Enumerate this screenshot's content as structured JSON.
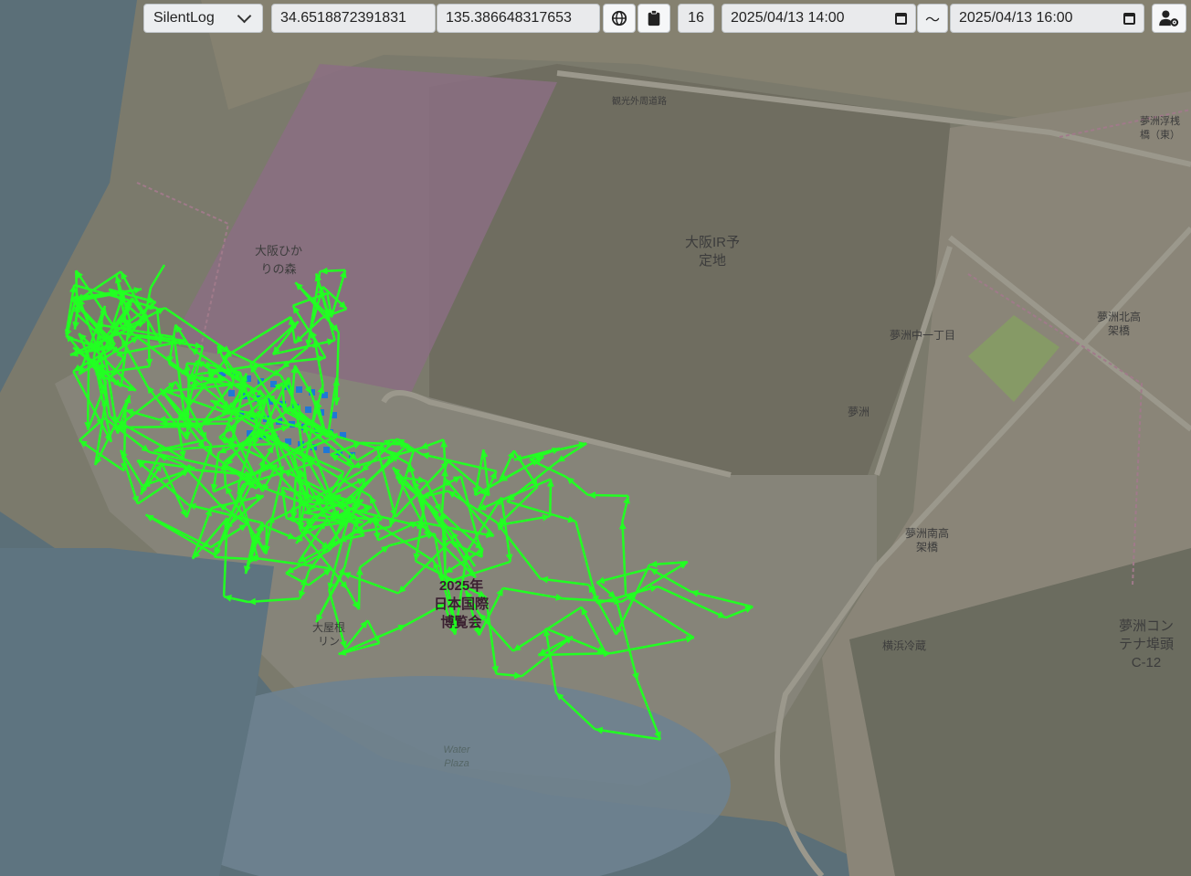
{
  "toolbar": {
    "mode_select": "SilentLog",
    "latitude": "34.6518872391831",
    "longitude": "135.386648317653",
    "zoom": "16",
    "start_datetime": "2025/04/13 14:00",
    "range_separator": "〜",
    "end_datetime": "2025/04/13 16:00"
  },
  "icons": {
    "globe": "globe-icon",
    "clipboard": "clipboard-icon",
    "user_settings": "user-cog-icon",
    "calendar": "calendar-icon",
    "chevron": "chevron-down-icon"
  },
  "map": {
    "labels": {
      "osaka_ir": "大阪IR予\n定地",
      "hikari_forest": "大阪ひか\nりの森",
      "yumeshima_1": "夢洲中一丁目",
      "yumeshima": "夢洲",
      "north_bridge": "夢洲北高\n架橋",
      "south_bridge": "夢洲南高\n架橋",
      "container_terminal": "夢洲コン\nテナ埠頭\nC-12",
      "east_bridge": "夢洲浮桟\n橋（東）",
      "yokohama_reizo": "横浜冷蔵",
      "road_1": "観光外周道路",
      "water_plaza": "Water\nPlaza",
      "ring": "大屋根\nリン",
      "expo": "2025年\n日本国際\n博覧会"
    },
    "colors": {
      "water": "#5b6f78",
      "land": "#7c7c6e",
      "site": "#8f8b82",
      "forest": "#8a6f82",
      "track": "#22ff22",
      "marker": "#1f78d6"
    }
  }
}
